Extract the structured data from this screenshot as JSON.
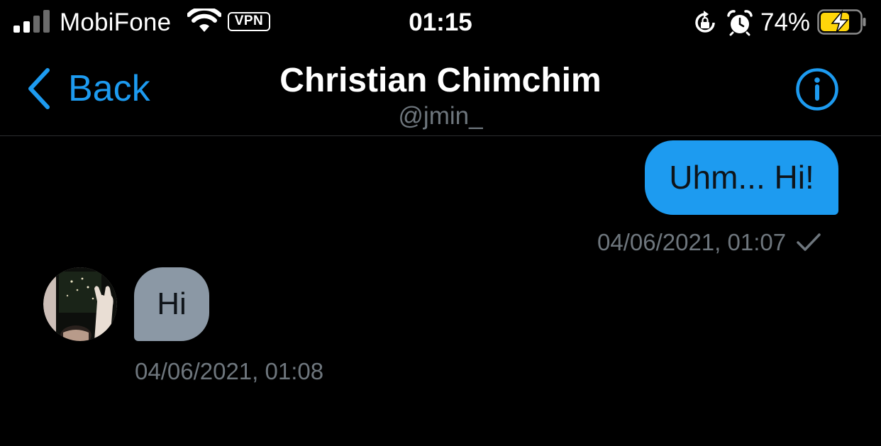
{
  "status_bar": {
    "carrier": "MobiFone",
    "vpn": "VPN",
    "time": "01:15",
    "battery_percent": "74%",
    "battery_level": 0.74,
    "charging": true,
    "icons": [
      "signal-icon",
      "wifi-icon",
      "rotation-lock-icon",
      "alarm-icon",
      "battery-icon"
    ]
  },
  "nav": {
    "back_label": "Back",
    "title": "Christian Chimchim",
    "handle": "@jmin_",
    "info_icon": "info-icon"
  },
  "messages": [
    {
      "direction": "outgoing",
      "text": "Uhm... Hi!",
      "timestamp": "04/06/2021, 01:07",
      "status_icon": "check-icon"
    },
    {
      "direction": "incoming",
      "text": "Hi",
      "timestamp": "04/06/2021, 01:08",
      "avatar": "avatar"
    }
  ],
  "colors": {
    "background": "#000000",
    "accent": "#1d9bf0",
    "outgoing_bubble": "#1d9bf0",
    "incoming_bubble": "#8b98a5",
    "secondary_text": "#6e767d",
    "battery_fill": "#ffd60a"
  }
}
